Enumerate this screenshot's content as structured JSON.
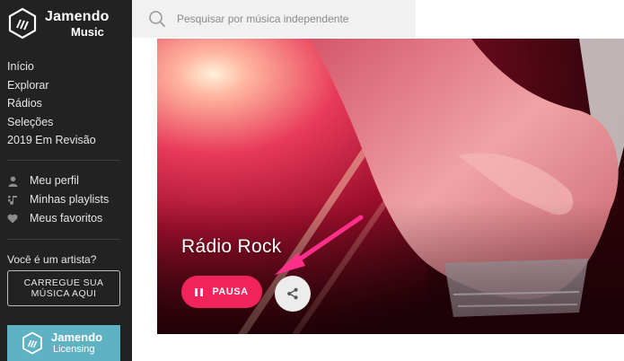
{
  "brand": {
    "name": "Jamendo",
    "sub": "Music"
  },
  "nav": [
    {
      "label": "Início"
    },
    {
      "label": "Explorar"
    },
    {
      "label": "Rádios"
    },
    {
      "label": "Seleções"
    },
    {
      "label": "2019 Em Revisão"
    }
  ],
  "user_nav": [
    {
      "label": "Meu perfil",
      "icon": "user-icon"
    },
    {
      "label": "Minhas playlists",
      "icon": "playlist-icon"
    },
    {
      "label": "Meus favoritos",
      "icon": "heart-icon"
    }
  ],
  "artist": {
    "question": "Você é um artista?",
    "upload_label": "CARREGUE SUA MÚSICA AQUI"
  },
  "licensing": {
    "name": "Jamendo",
    "sub": "Licensing"
  },
  "search": {
    "placeholder": "Pesquisar por música independente"
  },
  "hero": {
    "title": "Rádio Rock",
    "pause_label": "PAUSA"
  },
  "colors": {
    "sidebar": "#222222",
    "accent": "#f0245a",
    "licensing": "#5fb2c2",
    "annotation_arrow": "#ff2f8a"
  }
}
